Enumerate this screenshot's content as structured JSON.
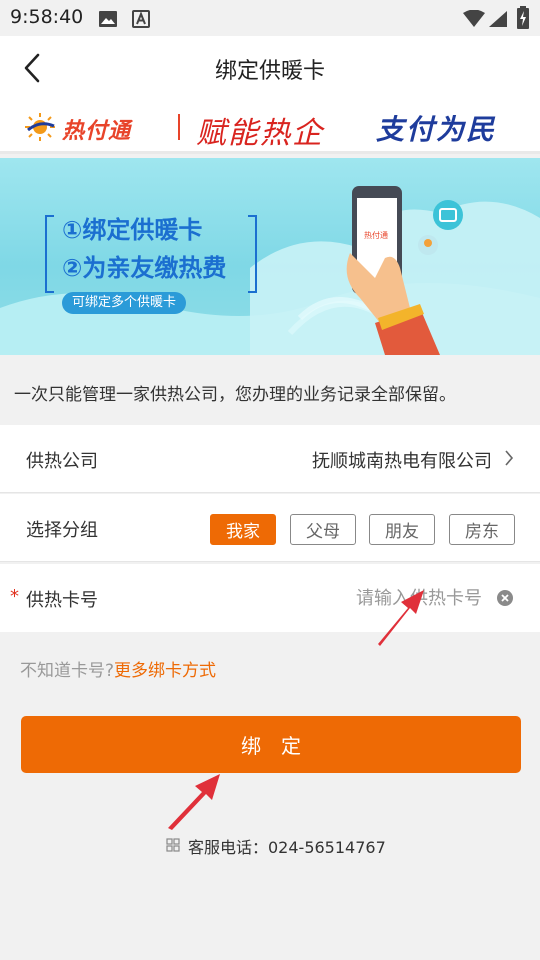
{
  "status_bar": {
    "time": "9:58:40",
    "icons": [
      "image-icon",
      "a-notification-icon",
      "wifi-icon",
      "signal-icon",
      "battery-charging-icon"
    ]
  },
  "app_bar": {
    "back_icon": "chevron-left-icon",
    "title": "绑定供暖卡"
  },
  "brand": {
    "logo_text": "热付通",
    "slogan_1": "赋能热企",
    "slogan_2": "支付为民"
  },
  "banner": {
    "line_1": "①绑定供暖卡",
    "line_2": "②为亲友缴热费",
    "tag": "可绑定多个供暖卡"
  },
  "notice": "一次只能管理一家供热公司，您办理的业务记录全部保留。",
  "form": {
    "company": {
      "label": "供热公司",
      "value": "抚顺城南热电有限公司"
    },
    "group": {
      "label": "选择分组",
      "options": [
        "我家",
        "父母",
        "朋友",
        "房东"
      ],
      "selected": "我家"
    },
    "card": {
      "required_mark": "*",
      "label": "供热卡号",
      "placeholder": "请输入供热卡号",
      "value": ""
    }
  },
  "help": {
    "question": "不知道卡号?",
    "link": "更多绑卡方式"
  },
  "bind_button": "绑定",
  "hotline": {
    "text": "客服电话：024-56514767"
  },
  "colors": {
    "accent": "#ee6a05",
    "required": "#e0301e",
    "arrow": "#e0303a"
  }
}
